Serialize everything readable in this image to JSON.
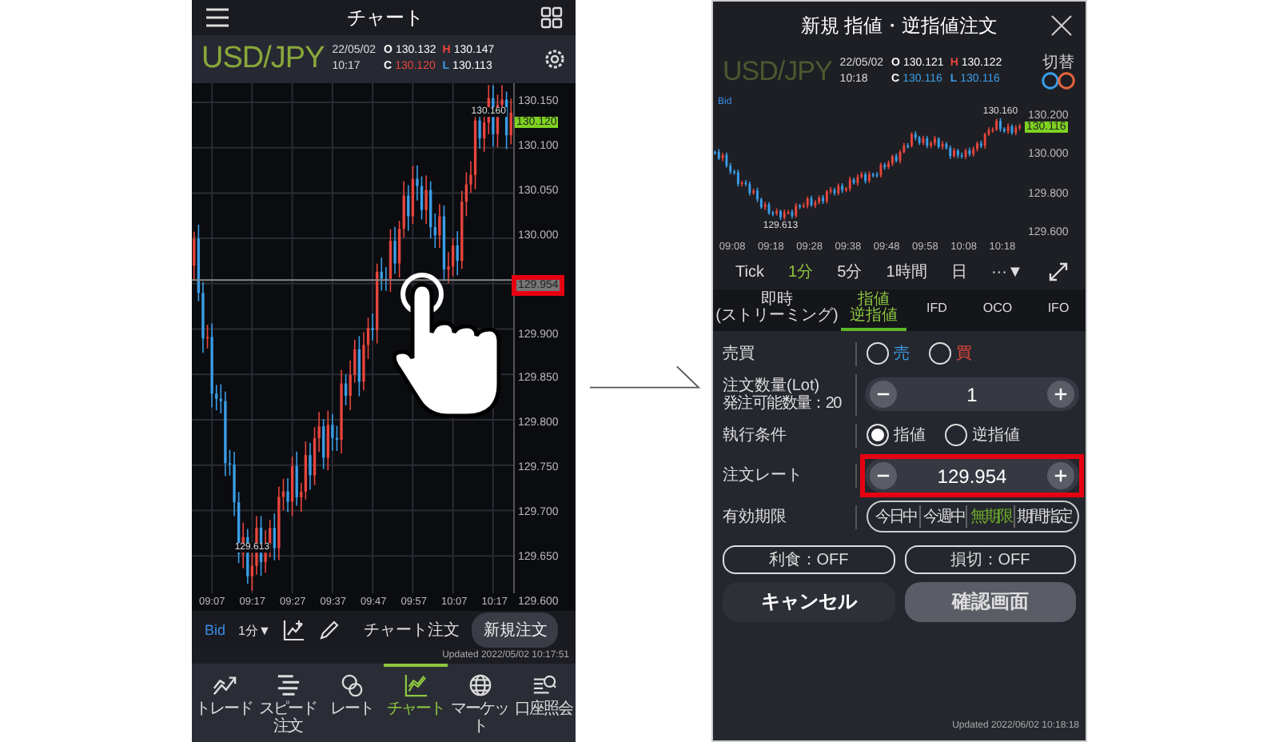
{
  "left_screen": {
    "header": {
      "title": "チャート"
    },
    "quote_bar": {
      "pair": "USD/JPY",
      "date": "22/05/02",
      "time": "10:17",
      "quotes": [
        {
          "label": "O",
          "kind": "open",
          "value": "130.132",
          "color": "#ffffff"
        },
        {
          "label": "H",
          "kind": "high",
          "value": "130.147",
          "color": "#ffffff"
        },
        {
          "label": "C",
          "kind": "close",
          "value": "130.120",
          "color": "#e8453c"
        },
        {
          "label": "L",
          "kind": "low",
          "value": "130.113",
          "color": "#ffffff"
        }
      ]
    },
    "chart": {
      "high_label": "130.160",
      "low_label": "129.613",
      "current_price": "130.120",
      "price_ticks": [
        {
          "label": "130.150",
          "kind": "tick"
        },
        {
          "label": "130.100",
          "kind": "tick"
        },
        {
          "label": "130.050",
          "kind": "tick"
        },
        {
          "label": "130.000",
          "kind": "tick"
        },
        {
          "label": "129.954",
          "kind": "crosshair",
          "highlighted": true
        },
        {
          "label": "129.900",
          "kind": "tick"
        },
        {
          "label": "129.850",
          "kind": "tick"
        },
        {
          "label": "129.800",
          "kind": "tick"
        },
        {
          "label": "129.750",
          "kind": "tick"
        },
        {
          "label": "129.700",
          "kind": "tick"
        },
        {
          "label": "129.650",
          "kind": "tick"
        },
        {
          "label": "129.600",
          "kind": "tick"
        }
      ],
      "time_ticks": [
        "09:07",
        "09:17",
        "09:27",
        "09:37",
        "09:47",
        "09:57",
        "10:07",
        "10:17"
      ]
    },
    "toolbar": {
      "price_type": "Bid",
      "interval": "1分▼",
      "chart_order": "チャート注文",
      "new_order": "新規注文"
    },
    "updated": "Updated  2022/05/02 10:17:51",
    "nav": [
      {
        "label": "トレード",
        "kind": "trade",
        "selected": false
      },
      {
        "label": "スピード注文",
        "kind": "speed",
        "selected": false
      },
      {
        "label": "レート",
        "kind": "rate",
        "selected": false
      },
      {
        "label": "チャート",
        "kind": "chart",
        "selected": true
      },
      {
        "label": "マーケット",
        "kind": "market",
        "selected": false
      },
      {
        "label": "口座照会",
        "kind": "account",
        "selected": false
      }
    ]
  },
  "right_screen": {
    "header": {
      "title": "新規 指値・逆指値注文"
    },
    "quote_bar": {
      "pair": "USD/JPY",
      "date": "22/05/02",
      "time": "10:18",
      "switch_label": "切替",
      "quotes": [
        {
          "label": "O",
          "kind": "open",
          "value": "130.121",
          "color": "#ffffff"
        },
        {
          "label": "H",
          "kind": "high",
          "value": "130.122",
          "color": "#ffffff"
        },
        {
          "label": "C",
          "kind": "close",
          "value": "130.116",
          "color": "#3a9ee8"
        },
        {
          "label": "L",
          "kind": "low",
          "value": "130.116",
          "color": "#3a9ee8"
        }
      ]
    },
    "chart": {
      "price_type": "Bid",
      "high_label": "130.160",
      "low_label": "129.613",
      "current_price": "130.116",
      "price_ticks": [
        "130.200",
        "130.000",
        "129.800",
        "129.600"
      ],
      "time_ticks": [
        "09:08",
        "09:18",
        "09:28",
        "09:38",
        "09:48",
        "09:58",
        "10:08",
        "10:18"
      ]
    },
    "periods": [
      {
        "label": "Tick",
        "selected": false
      },
      {
        "label": "1分",
        "selected": true
      },
      {
        "label": "5分",
        "selected": false
      },
      {
        "label": "1時間",
        "selected": false
      },
      {
        "label": "日",
        "selected": false
      },
      {
        "label": "···▼",
        "selected": false
      }
    ],
    "order_tabs": [
      {
        "lines": [
          "即時",
          "(ストリーミング)"
        ],
        "selected": false
      },
      {
        "lines": [
          "指値",
          "逆指値"
        ],
        "selected": true
      },
      {
        "lines": [
          "IFD"
        ],
        "selected": false
      },
      {
        "lines": [
          "OCO"
        ],
        "selected": false
      },
      {
        "lines": [
          "IFO"
        ],
        "selected": false
      }
    ],
    "form": [
      {
        "kind": "radio",
        "label": "売買",
        "options": [
          {
            "label": "売",
            "color": "#3a9ee8",
            "selected": false
          },
          {
            "label": "買",
            "color": "#e8453c",
            "selected": false
          }
        ]
      },
      {
        "kind": "stepper",
        "label": "注文数量(Lot)",
        "sublabel": "発注可能数量：20",
        "value": "1",
        "highlighted": false
      },
      {
        "kind": "radio",
        "label": "執行条件",
        "options": [
          {
            "label": "指値",
            "selected": true
          },
          {
            "label": "逆指値",
            "selected": false
          }
        ]
      },
      {
        "kind": "stepper",
        "label": "注文レート",
        "value": "129.954",
        "highlighted": true
      },
      {
        "kind": "segmented",
        "label": "有効期限",
        "options": [
          {
            "label": "今日中",
            "selected": false
          },
          {
            "label": "今週中",
            "selected": false
          },
          {
            "label": "無期限",
            "selected": true
          },
          {
            "label": "期間指定",
            "selected": false
          }
        ]
      }
    ],
    "toggles": [
      "利食：OFF",
      "損切：OFF"
    ],
    "buttons": [
      {
        "label": "キャンセル",
        "kind": "secondary"
      },
      {
        "label": "確認画面",
        "kind": "primary"
      }
    ],
    "updated": "Updated  2022/06/02 10:18:18"
  }
}
